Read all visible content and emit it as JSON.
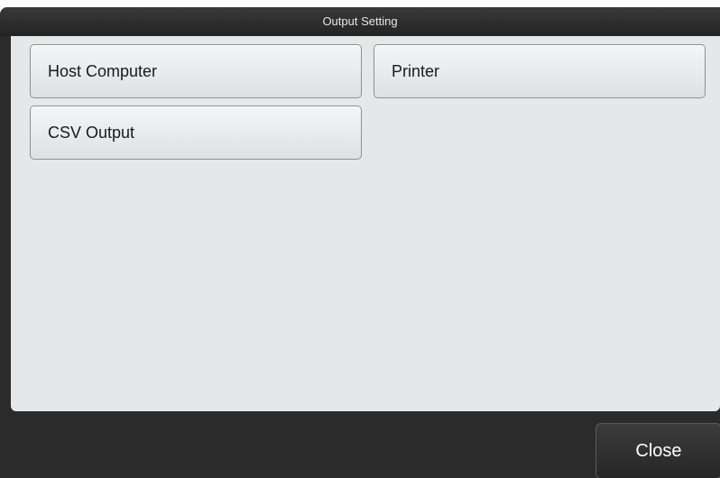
{
  "window": {
    "title": "Output Setting"
  },
  "options": [
    {
      "label": "Host Computer"
    },
    {
      "label": "Printer"
    },
    {
      "label": "CSV Output"
    }
  ],
  "footer": {
    "close_label": "Close"
  },
  "colors": {
    "chrome": "#2b2b2b",
    "panel": "#e6e7e9",
    "button_face": "#eaebed",
    "button_border": "#8e8f93"
  }
}
